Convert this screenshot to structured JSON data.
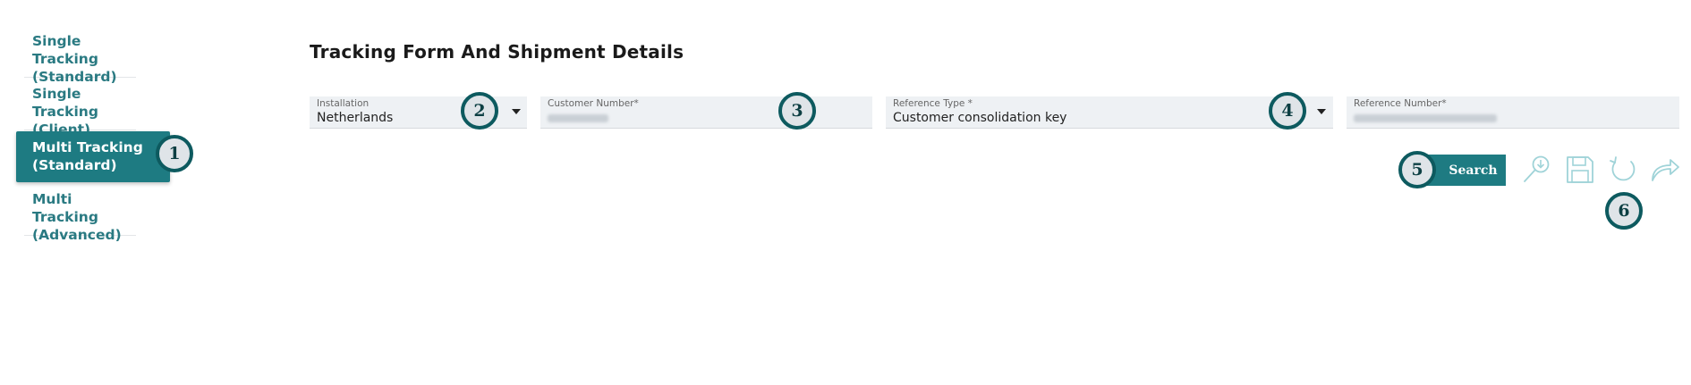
{
  "sidebar": {
    "items": [
      {
        "label": "Single Tracking (Standard)",
        "active": false
      },
      {
        "label": "Single Tracking (Client)",
        "active": false
      },
      {
        "label": "Multi Tracking (Standard)",
        "active": true
      },
      {
        "label": "Multi Tracking (Advanced)",
        "active": false
      }
    ]
  },
  "page": {
    "title": "Tracking Form And Shipment Details"
  },
  "form": {
    "installation": {
      "label": "Installation",
      "value": "Netherlands"
    },
    "customer_number": {
      "label": "Customer Number*"
    },
    "reference_type": {
      "label": "Reference Type *",
      "value": "Customer consolidation key"
    },
    "reference_number": {
      "label": "Reference Number*"
    }
  },
  "actions": {
    "search_label": "Search"
  },
  "badges": [
    "1",
    "2",
    "3",
    "4",
    "5",
    "6"
  ],
  "icons": [
    "search-download-icon",
    "save-icon",
    "reset-icon",
    "share-icon"
  ],
  "colors": {
    "accent": "#1e7b82",
    "badge_border": "#0d5a5f",
    "field_bg": "#eef1f4",
    "icon": "#9fd3d8"
  }
}
